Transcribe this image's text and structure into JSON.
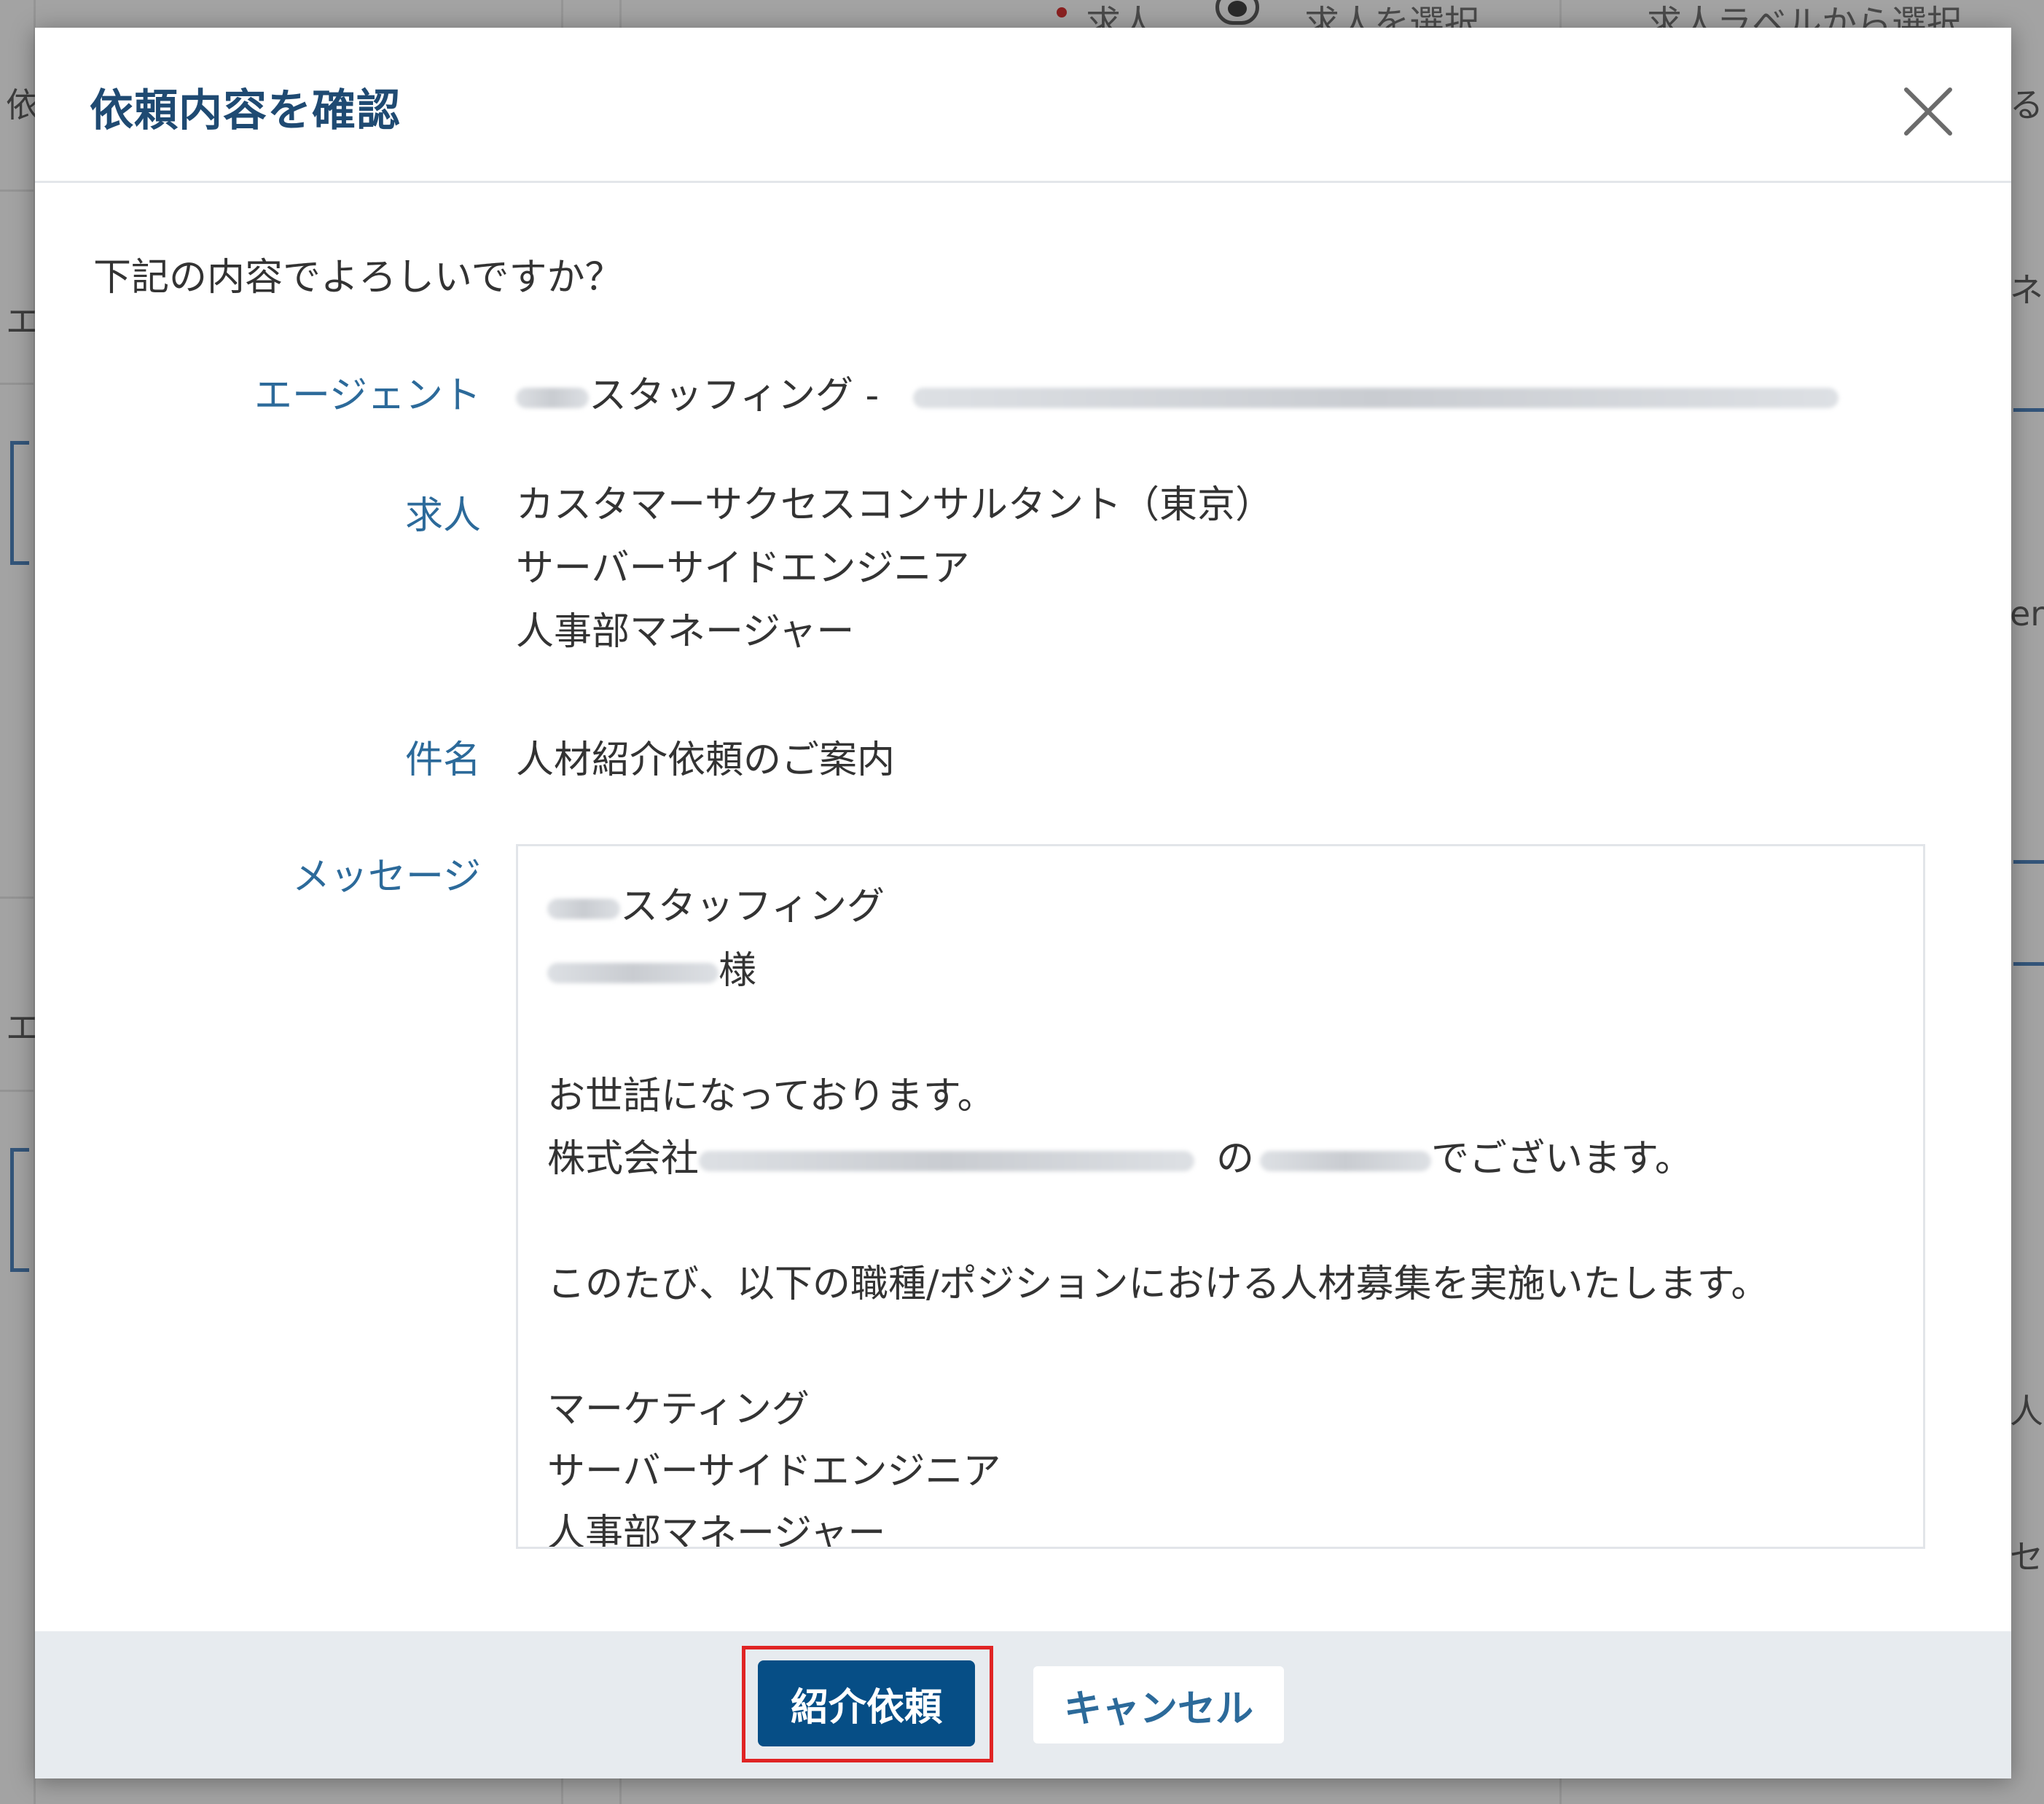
{
  "background": {
    "top_items": [
      "求人",
      "求人を選択",
      "求人ラベルから選択"
    ],
    "side_fragments": [
      "依",
      "エ",
      "エ",
      "る",
      "ネ",
      "er",
      "人",
      "セ"
    ]
  },
  "modal": {
    "title": "依頼内容を確認",
    "close_icon": "close-icon",
    "question": "下記の内容でよろしいですか？",
    "agent": {
      "label": "エージェント",
      "value": "スタッフィング -"
    },
    "jobs": {
      "label": "求人",
      "items": [
        "カスタマーサクセスコンサルタント（東京）",
        "サーバーサイドエンジニア",
        "人事部マネージャー"
      ]
    },
    "subject": {
      "label": "件名",
      "value": "人材紹介依頼のご案内"
    },
    "message": {
      "label": "メッセージ",
      "lines": {
        "l1": "スタッフィング",
        "l2": "様",
        "l3": "お世話になっております。",
        "l4a": "株式会社",
        "l4b": "の",
        "l4c": "でございます。",
        "l5": "このたび、以下の職種/ポジションにおける人材募集を実施いたします。",
        "l6": "マーケティング",
        "l7": "サーバーサイドエンジニア",
        "l8": "人事部マネージャー"
      }
    },
    "footer": {
      "submit_label": "紹介依頼",
      "cancel_label": "キャンセル"
    }
  },
  "colors": {
    "title": "#1f4a72",
    "label": "#2c6a9a",
    "primary_button": "#064e86",
    "highlight": "#e02424",
    "footer_bg": "#e7ebef"
  }
}
